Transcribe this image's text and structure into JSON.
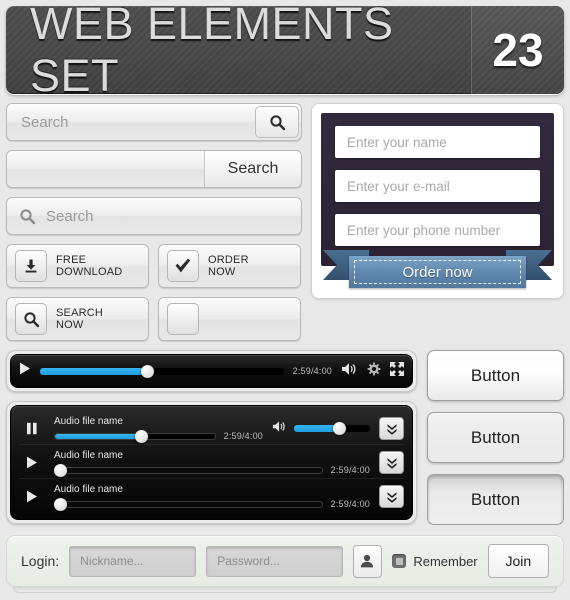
{
  "header": {
    "title": "WEB ELEMENTS SET",
    "number": "23"
  },
  "search": {
    "one": {
      "placeholder": "Search",
      "icon": "search-icon"
    },
    "two": {
      "value": "",
      "button_label": "Search"
    },
    "three": {
      "placeholder": "Search",
      "icon": "search-icon"
    }
  },
  "action_buttons": [
    {
      "icon": "download-icon",
      "line1": "FREE",
      "line2": "DOWNLOAD"
    },
    {
      "icon": "check-icon",
      "line1": "ORDER",
      "line2": "NOW"
    },
    {
      "icon": "search-icon",
      "line1": "SEARCH",
      "line2": "NOW"
    },
    {
      "icon": "blank-icon",
      "line1": "",
      "line2": ""
    }
  ],
  "order_form": {
    "fields": [
      {
        "placeholder": "Enter your name"
      },
      {
        "placeholder": "Enter your e-mail"
      },
      {
        "placeholder": "Enter your phone number"
      }
    ],
    "ribbon_label": "Order now",
    "panel_color": "#2b2234",
    "ribbon_color": "#5d86ad"
  },
  "video_player": {
    "play_icon": "play-icon",
    "progress_percent": 44,
    "time": "2:59/4:00",
    "volume_icon": "volume-icon",
    "settings_icon": "gear-icon",
    "fullscreen_icon": "fullscreen-icon",
    "accent": "#1d9fe0"
  },
  "audio_player": {
    "tracks": [
      {
        "state_icon": "pause-icon",
        "name": "Audio file name",
        "progress_percent": 54,
        "time": "2:59/4:00",
        "volume_icon": "volume-icon",
        "volume_percent": 60,
        "expand_icon": "double-chevron-down-icon",
        "playing": true
      },
      {
        "state_icon": "play-icon",
        "name": "Audio file name",
        "progress_percent": 2,
        "time": "2:59/4:00",
        "expand_icon": "double-chevron-down-icon",
        "playing": false
      },
      {
        "state_icon": "play-icon",
        "name": "Audio file name",
        "progress_percent": 2,
        "time": "2:59/4:00",
        "expand_icon": "double-chevron-down-icon",
        "playing": false
      }
    ]
  },
  "buttons": [
    {
      "label": "Button",
      "state": "normal"
    },
    {
      "label": "Button",
      "state": "hover"
    },
    {
      "label": "Button",
      "state": "pressed"
    }
  ],
  "login": {
    "label": "Login:",
    "nickname_placeholder": "Nickname...",
    "password_placeholder": "Password...",
    "user_icon": "user-icon",
    "remember_label": "Remember",
    "remember_checked": true,
    "join_label": "Join"
  }
}
